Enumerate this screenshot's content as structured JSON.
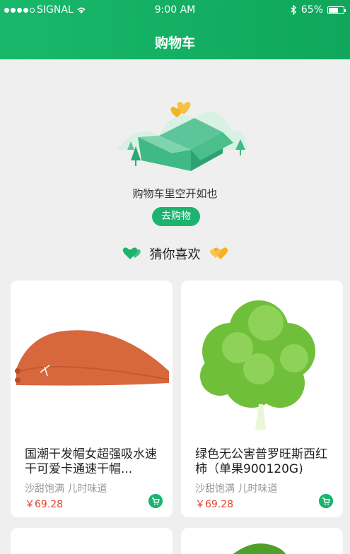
{
  "status_bar": {
    "carrier": "SIGNAL",
    "time": "9:00 AM",
    "battery": "65%"
  },
  "header": {
    "title": "购物车"
  },
  "empty_cart": {
    "message": "购物车里空开如也",
    "button": "去购物"
  },
  "recommend": {
    "title": "猜你喜欢"
  },
  "products": [
    {
      "name": "国潮干发帽女超强吸水速干可爱卡通速干帽...",
      "subtitle": "沙甜饱满 儿时味道",
      "price": "￥69.28"
    },
    {
      "name": "绿色无公害普罗旺斯西红柿（单果900120G)",
      "subtitle": "沙甜饱满 儿时味道",
      "price": "￥69.28"
    }
  ],
  "colors": {
    "brand": "#1bb36e",
    "price": "#e2432f",
    "heart_green": "#1bb36e",
    "heart_orange": "#f5b324"
  }
}
